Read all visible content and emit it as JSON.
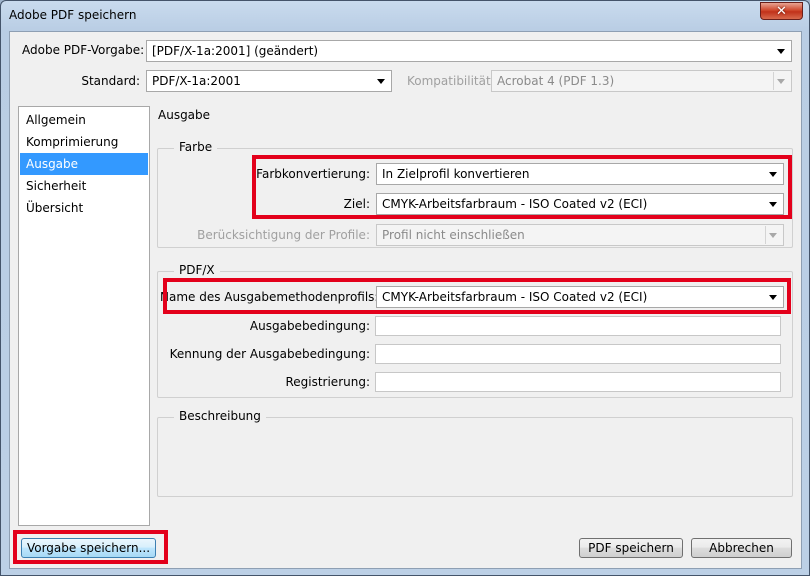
{
  "window": {
    "title": "Adobe PDF speichern",
    "close_symbol": "✕"
  },
  "top": {
    "preset_label": "Adobe PDF-Vorgabe:",
    "preset_value": "[PDF/X-1a:2001] (geändert)",
    "standard_label": "Standard:",
    "standard_value": "PDF/X-1a:2001",
    "compat_label": "Kompatibilität:",
    "compat_value": "Acrobat 4 (PDF 1.3)"
  },
  "sidebar": {
    "items": [
      {
        "label": "Allgemein"
      },
      {
        "label": "Komprimierung"
      },
      {
        "label": "Ausgabe"
      },
      {
        "label": "Sicherheit"
      },
      {
        "label": "Übersicht"
      }
    ],
    "selected": "Ausgabe"
  },
  "main": {
    "section_title": "Ausgabe",
    "farbe": {
      "title": "Farbe",
      "konvertierung_label": "Farbkonvertierung:",
      "konvertierung_value": "In Zielprofil konvertieren",
      "ziel_label": "Ziel:",
      "ziel_value": "CMYK-Arbeitsfarbraum - ISO Coated v2 (ECI)",
      "profile_label": "Berücksichtigung der Profile:",
      "profile_value": "Profil nicht einschließen"
    },
    "pdfx": {
      "title": "PDF/X",
      "profilname_label": "Name des Ausgabemethodenprofils:",
      "profilname_value": "CMYK-Arbeitsfarbraum - ISO Coated v2 (ECI)",
      "bedingung_label": "Ausgabebedingung:",
      "bedingung_value": "",
      "kennung_label": "Kennung der Ausgabebedingung:",
      "kennung_value": "",
      "registrierung_label": "Registrierung:",
      "registrierung_value": ""
    },
    "beschreibung": {
      "title": "Beschreibung"
    }
  },
  "buttons": {
    "save_preset": "Vorgabe speichern...",
    "save_pdf": "PDF speichern",
    "cancel": "Abbrechen"
  },
  "colors": {
    "highlight": "#e3001b",
    "selection": "#3399ff"
  }
}
